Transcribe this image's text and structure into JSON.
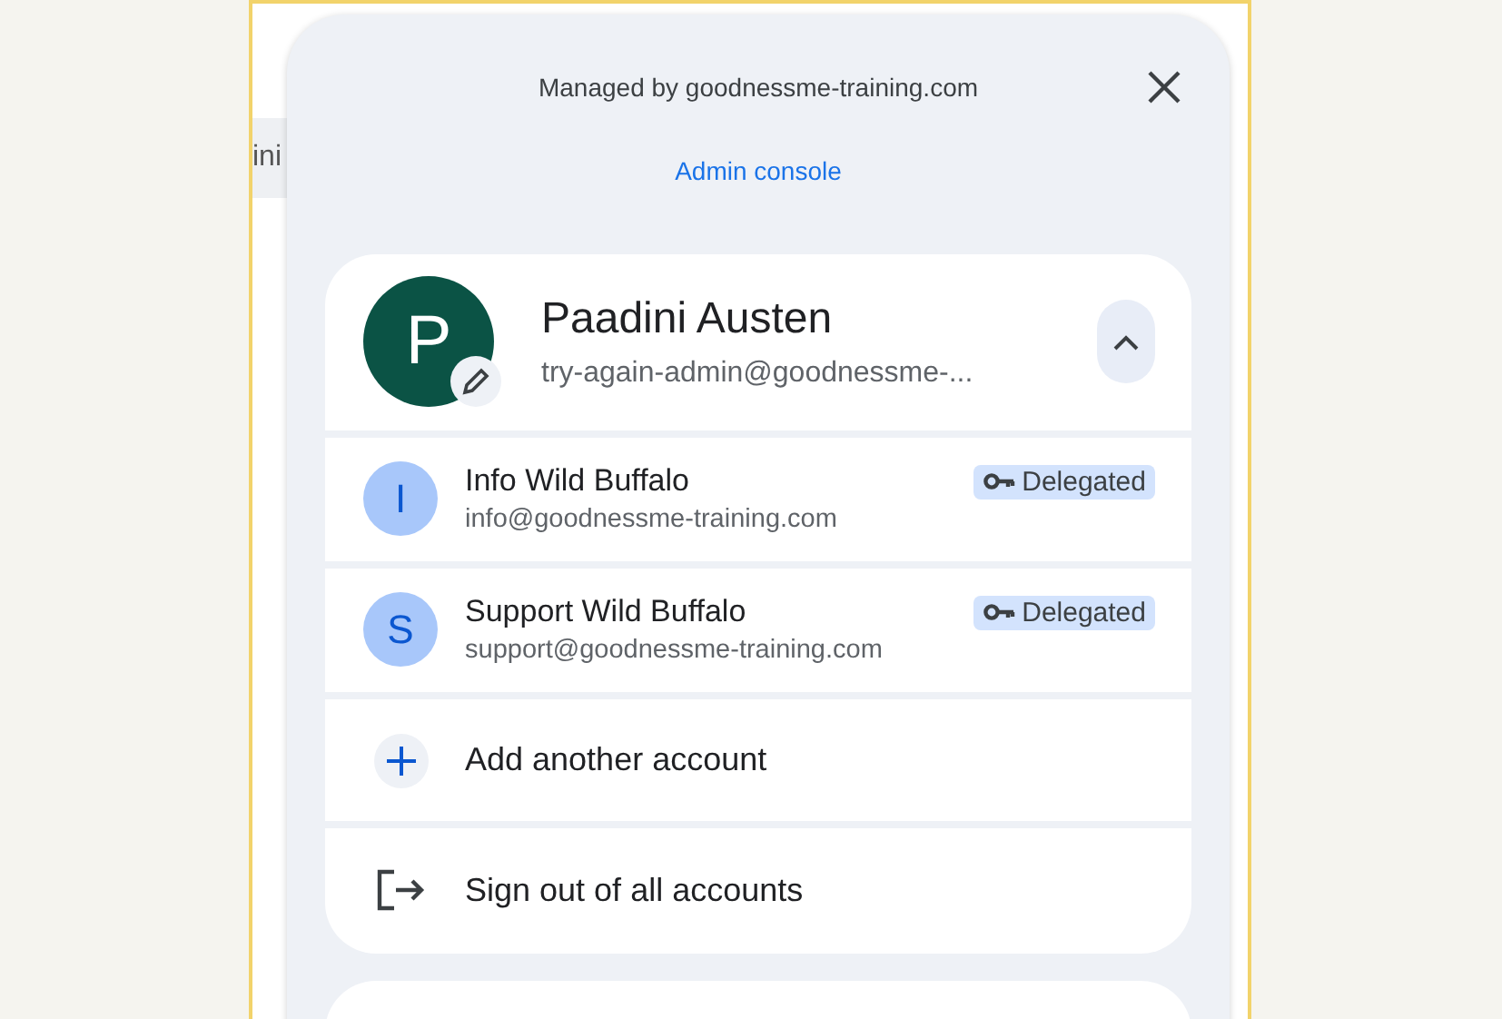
{
  "background_tab": {
    "label": "ini"
  },
  "panel": {
    "managed_by": "Managed by goodnessme-training.com",
    "admin_link": "Admin console"
  },
  "primary_account": {
    "initial": "P",
    "name": "Paadini Austen",
    "email": "try-again-admin@goodnessme-...",
    "expanded": true
  },
  "accounts": [
    {
      "initial": "I",
      "name": "Info Wild Buffalo",
      "email": "info@goodnessme-training.com",
      "badge": "Delegated"
    },
    {
      "initial": "S",
      "name": "Support Wild Buffalo",
      "email": "support@goodnessme-training.com",
      "badge": "Delegated"
    }
  ],
  "actions": [
    {
      "kind": "add",
      "label": "Add another account"
    },
    {
      "kind": "signout",
      "label": "Sign out of all accounts"
    }
  ]
}
